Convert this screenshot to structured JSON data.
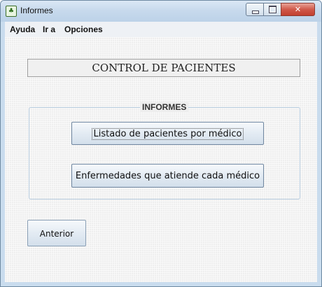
{
  "window": {
    "title": "Informes",
    "app_icon_glyph": "♣",
    "controls": {
      "minimize": "minimize",
      "maximize": "maximize",
      "close_glyph": "✕"
    }
  },
  "menubar": {
    "items": [
      {
        "label": "Ayuda"
      },
      {
        "label": "Ir a"
      },
      {
        "label": "Opciones"
      }
    ]
  },
  "main": {
    "header": "CONTROL DE PACIENTES",
    "group": {
      "title": "INFORMES",
      "buttons": [
        {
          "label": "Listado de pacientes por médico"
        },
        {
          "label": "Enfermedades que atiende cada médico"
        }
      ]
    },
    "back_button": "Anterior"
  },
  "colors": {
    "titlebar": "#c6d9ec",
    "close_button": "#d0594a",
    "button_border": "#6f86a0"
  }
}
